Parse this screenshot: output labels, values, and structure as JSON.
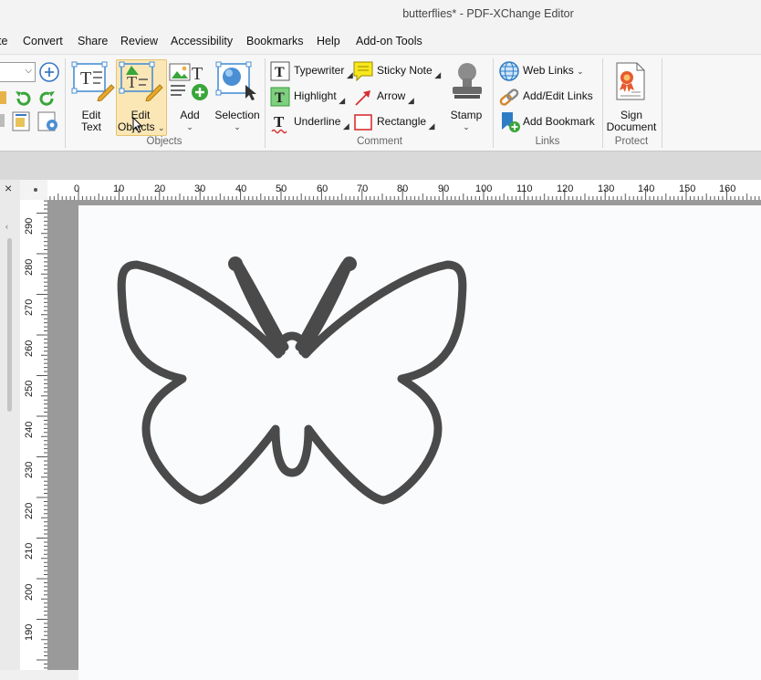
{
  "window": {
    "title": "butterflies* - PDF-XChange Editor"
  },
  "menu": [
    "te",
    "Convert",
    "Share",
    "Review",
    "Accessibility",
    "Bookmarks",
    "Help",
    "Add-on Tools"
  ],
  "ribbon": {
    "objects": {
      "group_label": "Objects",
      "edit_text": [
        "Edit",
        "Text"
      ],
      "edit_objects": [
        "Edit",
        "Objects"
      ],
      "add": "Add",
      "selection": "Selection"
    },
    "comment": {
      "group_label": "Comment",
      "typewriter": "Typewriter",
      "sticky_note": "Sticky Note",
      "highlight": "Highlight",
      "arrow": "Arrow",
      "underline": "Underline",
      "rectangle": "Rectangle",
      "stamp": "Stamp"
    },
    "links": {
      "group_label": "Links",
      "web_links": "Web Links",
      "add_edit_links": "Add/Edit Links",
      "add_bookmark": "Add Bookmark"
    },
    "protect": {
      "group_label": "Protect",
      "sign_document": [
        "Sign",
        "Document"
      ]
    }
  },
  "ruler": {
    "top": [
      "0",
      "10",
      "20",
      "30",
      "40",
      "50",
      "60",
      "70",
      "80",
      "90",
      "100",
      "110",
      "120",
      "130",
      "140",
      "150",
      "160"
    ],
    "left": [
      "290",
      "280",
      "270",
      "260",
      "250",
      "240",
      "230",
      "220",
      "210",
      "200",
      "190"
    ]
  },
  "panel": {
    "close": "×"
  },
  "colors": {
    "accent_selected": "#fbe7b6",
    "drawing_stroke": "#4a4a4a",
    "page_bg": "#fafbfd"
  }
}
